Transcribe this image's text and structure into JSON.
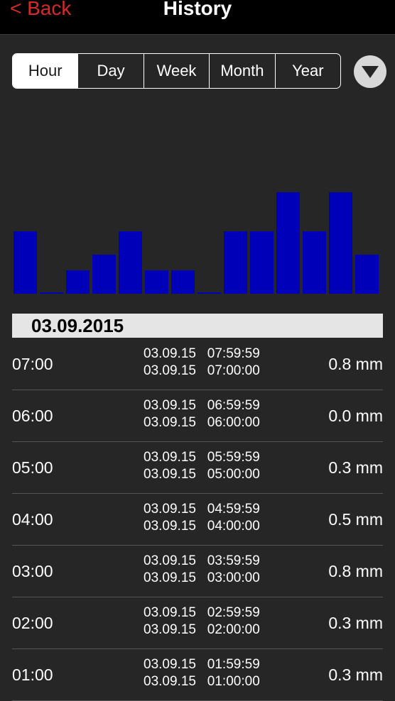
{
  "navbar": {
    "back_label": "< Back",
    "title": "History",
    "back_color": "#d42a2a"
  },
  "segments": [
    {
      "label": "Hour",
      "active": true
    },
    {
      "label": "Day",
      "active": false
    },
    {
      "label": "Week",
      "active": false
    },
    {
      "label": "Month",
      "active": false
    },
    {
      "label": "Year",
      "active": false
    }
  ],
  "dropdown_icon": "chevron-down-icon",
  "chart_data": {
    "type": "bar",
    "bar_color": "#0000b8",
    "values": [
      0.8,
      0.0,
      0.3,
      0.5,
      0.8,
      0.3,
      0.3,
      0.0,
      0.8,
      0.8,
      1.3,
      0.8,
      1.3,
      0.5
    ],
    "ylim": [
      0,
      2.4
    ]
  },
  "date_header": "03.09.2015",
  "rows": [
    {
      "hour": "07:00",
      "end": "03.09.15   07:59:59",
      "start": "03.09.15   07:00:00",
      "value": "0.8 mm"
    },
    {
      "hour": "06:00",
      "end": "03.09.15   06:59:59",
      "start": "03.09.15   06:00:00",
      "value": "0.0 mm"
    },
    {
      "hour": "05:00",
      "end": "03.09.15   05:59:59",
      "start": "03.09.15   05:00:00",
      "value": "0.3 mm"
    },
    {
      "hour": "04:00",
      "end": "03.09.15   04:59:59",
      "start": "03.09.15   04:00:00",
      "value": "0.5 mm"
    },
    {
      "hour": "03:00",
      "end": "03.09.15   03:59:59",
      "start": "03.09.15   03:00:00",
      "value": "0.8 mm"
    },
    {
      "hour": "02:00",
      "end": "03.09.15   02:59:59",
      "start": "03.09.15   02:00:00",
      "value": "0.3 mm"
    },
    {
      "hour": "01:00",
      "end": "03.09.15   01:59:59",
      "start": "03.09.15   01:00:00",
      "value": "0.3 mm"
    }
  ]
}
